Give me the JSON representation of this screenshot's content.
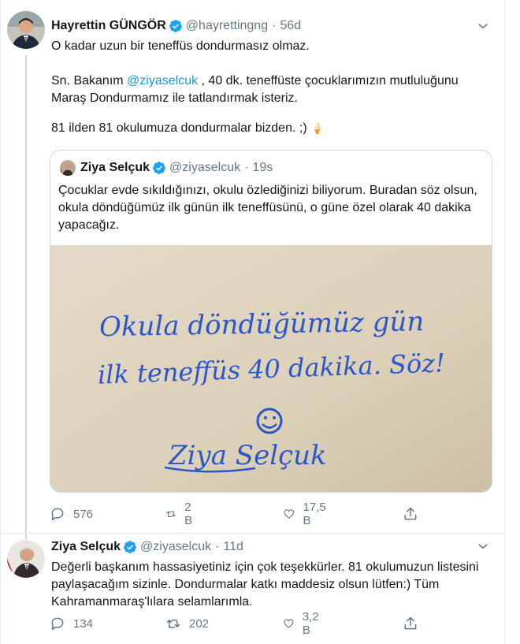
{
  "tweets": [
    {
      "name": "Hayrettin GÜNGÖR",
      "handle": "@hayrettingng",
      "dot": "·",
      "time": "56d",
      "line1": "O kadar uzun bir teneffüs dondurmasız olmaz.",
      "para2_prefix": "Sn. Bakanım ",
      "para2_mention": "@ziyaselcuk",
      "para2_suffix": " , 40 dk. teneffüste çocuklarımızın mutluluğunu Maraş Dondurmamız ile tatlandırmak isteriz.",
      "line3": "81 ilden 81 okulumuza dondurmalar bizden. ;)",
      "emoji": "🍦",
      "quote": {
        "name": "Ziya Selçuk",
        "handle": "@ziyaselcuk",
        "dot": "·",
        "time": "19s",
        "text": "Çocuklar evde sıkıldığınızı, okulu özlediğinizi biliyorum. Buradan söz olsun, okula döndüğümüz ilk günün ilk teneffüsünü, o güne özel olarak 40 dakika yapacağız.",
        "image_line1": "Okula döndüğümüz gün",
        "image_line2": "ilk teneffüs 40 dakika. Söz!",
        "image_signature": "Ziya Selçuk"
      },
      "actions": {
        "replies": "576",
        "retweets": "2 B",
        "likes": "17,5 B"
      }
    },
    {
      "name": "Ziya Selçuk",
      "handle": "@ziyaselcuk",
      "dot": "·",
      "time": "11d",
      "text": "Değerli başkanım hassasiyetiniz için çok teşekkürler. 81 okulumuzun listesini paylaşacağım sizinle. Dondurmalar katkı maddesiz olsun lütfen:) Tüm Kahramanmaraş'lılara selamlarımla.",
      "actions": {
        "replies": "134",
        "retweets": "202",
        "likes": "3,2 B"
      }
    }
  ],
  "colors": {
    "accent": "#1da1f2",
    "mention": "#1b95e0",
    "secondary_text": "#657786",
    "border": "#ccd6dd",
    "ink": "#2b57c9",
    "paper": "#ddd2bd"
  },
  "icons": [
    "verified-badge-icon",
    "chevron-down-icon",
    "reply-icon",
    "retweet-icon",
    "like-icon",
    "share-icon",
    "smiley-face-icon"
  ]
}
